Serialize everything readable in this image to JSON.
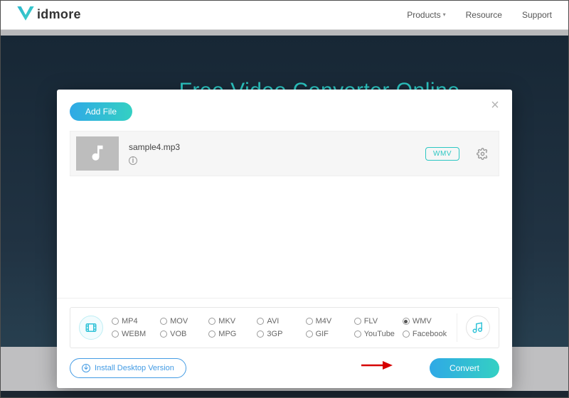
{
  "brand": {
    "name": "idmore"
  },
  "nav": {
    "products": "Products",
    "resource": "Resource",
    "support": "Support"
  },
  "hero": {
    "title": "Free Video Converter Online"
  },
  "modal": {
    "add_file": "Add File",
    "file": {
      "name": "sample4.mp3",
      "format_badge": "WMV"
    },
    "formats": {
      "row1": [
        "MP4",
        "MOV",
        "MKV",
        "AVI",
        "M4V",
        "FLV",
        "WMV"
      ],
      "row2": [
        "WEBM",
        "VOB",
        "MPG",
        "3GP",
        "GIF",
        "YouTube",
        "Facebook"
      ],
      "selected": "WMV"
    },
    "install_label": "Install Desktop Version",
    "convert_label": "Convert"
  }
}
